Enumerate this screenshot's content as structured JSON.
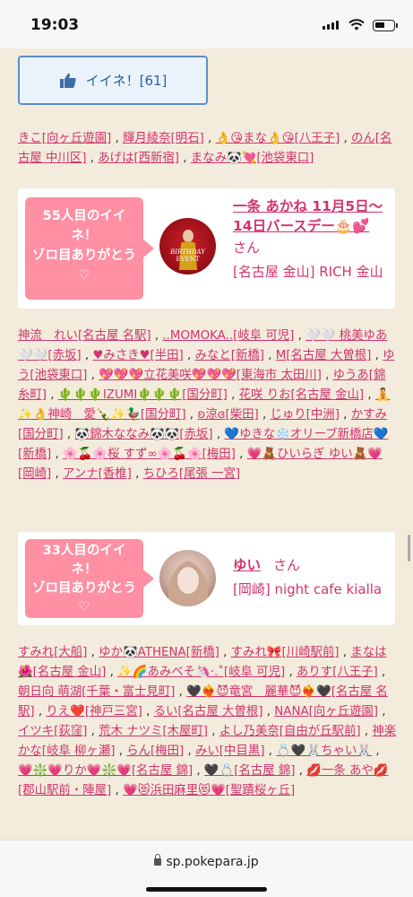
{
  "status": {
    "time": "19:03"
  },
  "like_button": {
    "label": "イイネ！[61]"
  },
  "names1": [
    {
      "text": "きこ[向ヶ丘遊園]",
      "sep": " , "
    },
    {
      "text": "輝月綾奈[明石]",
      "sep": " , "
    },
    {
      "text": "👌😘まな👌😘[八王子]",
      "sep": " , "
    },
    {
      "text": "のん[名古屋 中川区]",
      "sep": " , "
    },
    {
      "text": "あげは[西新宿]",
      "sep": " , "
    },
    {
      "text": "まなみ🐼💘[池袋東口]",
      "sep": ""
    }
  ],
  "card1": {
    "bubble_line1": "55人目のイイ",
    "bubble_line2": "ネ！",
    "bubble_line3": "ゾロ目ありがとう",
    "bubble_heart": "♡",
    "avatar_text1": "BIRTHDAY",
    "avatar_text2": "EVENT",
    "title": "一条 あかね 11月5日〜14日バースデー🎂💕",
    "san": "さん",
    "info": "[名古屋 金山] RICH 金山"
  },
  "names2": [
    {
      "text": "神流　れい[名古屋 名駅]",
      "sep": " , "
    },
    {
      "text": "..MOMOKA..[岐阜 可児]",
      "sep": " , "
    },
    {
      "text": "🤍🤍 桃美ゆあ🤍🤍[赤坂]",
      "sep": " , "
    },
    {
      "text": "♥みさき♥[半田]",
      "sep": " , "
    },
    {
      "text": "みなと[新橋]",
      "sep": " , "
    },
    {
      "text": "M[名古屋 大曽根]",
      "sep": " , "
    },
    {
      "text": "ゆう[池袋東口]",
      "sep": " , "
    },
    {
      "text": "💖💖💖立花美咲💖💖💖[東海市 太田川]",
      "sep": " , "
    },
    {
      "text": "ゆうあ[錦糸町]",
      "sep": " , "
    },
    {
      "text": "🌵🌵🌵IZUMI🌵🌵🌵[国分町]",
      "sep": " , "
    },
    {
      "text": "花咲 りお[名古屋 金山]",
      "sep": " , "
    },
    {
      "text": "🧘✨👌神崎　愛🍾✨🦆[国分町]",
      "sep": " , "
    },
    {
      "text": "ʚ涼ɞ[柴田]",
      "sep": " , "
    },
    {
      "text": "じゅり[中洲]",
      "sep": " , "
    },
    {
      "text": "かすみ[国分町]",
      "sep": " , "
    },
    {
      "text": "🐼錦木ななみ🐼🐼[赤坂]",
      "sep": " , "
    },
    {
      "text": "💙ゆきな❄️オリーブ新橋店💙[新橋]",
      "sep": " , "
    },
    {
      "text": "🌸🍒🌸桜 すず∞🌸🍒🌸[梅田]",
      "sep": " , "
    },
    {
      "text": "💗🧸ひいらぎ ゆい🧸💗[岡崎]",
      "sep": " , "
    },
    {
      "text": "アンナ[香椎]",
      "sep": " , "
    },
    {
      "text": "ちひろ[尾張 一宮]",
      "sep": ""
    }
  ],
  "card2": {
    "bubble_line1": "33人目のイイ",
    "bubble_line2": "ネ！",
    "bubble_line3": "ゾロ目ありがとう",
    "bubble_heart": "♡",
    "title": "ゆい",
    "san": "さん",
    "info": "[岡崎] night cafe kialla"
  },
  "names3": [
    {
      "text": "すみれ[大船]",
      "sep": " , "
    },
    {
      "text": "ゆか🐼ATHENA[新橋]",
      "sep": " , "
    },
    {
      "text": "すみれ🎀[川崎駅前]",
      "sep": " , "
    },
    {
      "text": "まなは🌺[名古屋 金山]",
      "sep": " , "
    },
    {
      "text": "✨🌈あみべそ🦄·.˚[岐阜 可児]",
      "sep": " , "
    },
    {
      "text": "ありす[八王子]",
      "sep": " , "
    },
    {
      "text": "朝日向 萌湖[千葉・富士見町]",
      "sep": " , "
    },
    {
      "text": "🖤❤️‍🔥😈竜宮　麗華😈❤️‍🔥🖤[名古屋 名駅]",
      "sep": " , "
    },
    {
      "text": "りえ❤️[神戸三宮]",
      "sep": " , "
    },
    {
      "text": "るい[名古屋 大曽根]",
      "sep": " , "
    },
    {
      "text": "NANA[向ヶ丘遊園]",
      "sep": " , "
    },
    {
      "text": "イツキ[荻窪]",
      "sep": " , "
    },
    {
      "text": "荒木 ナツミ[木屋町]",
      "sep": " , "
    },
    {
      "text": "よし乃美奈[自由が丘駅前]",
      "sep": " , "
    },
    {
      "text": "神楽 かな[岐阜 柳ヶ瀬]",
      "sep": " , "
    },
    {
      "text": "らん[梅田]",
      "sep": " , "
    },
    {
      "text": "みい[中目黒]",
      "sep": " , "
    },
    {
      "text": "💍🖤🐰ちゃい🐰",
      "sep": " , "
    },
    {
      "text": "💗❇️💗りか💗❇️💗[名古屋 錦]",
      "sep": " , "
    },
    {
      "text": "🖤💍[名古屋 錦]",
      "sep": " , "
    },
    {
      "text": "💋一条 あや💋[郡山駅前・陣屋]",
      "sep": " , "
    },
    {
      "text": "💗😻浜田麻里😻💗[聖蹟桜ヶ丘]",
      "sep": ""
    }
  ],
  "browser": {
    "url": "sp.pokepara.jp"
  },
  "colors": {
    "accent_pink": "#d1336e",
    "bubble_pink": "#ff8fa3",
    "like_blue": "#5b8fc9",
    "background": "#f3ecdc"
  }
}
